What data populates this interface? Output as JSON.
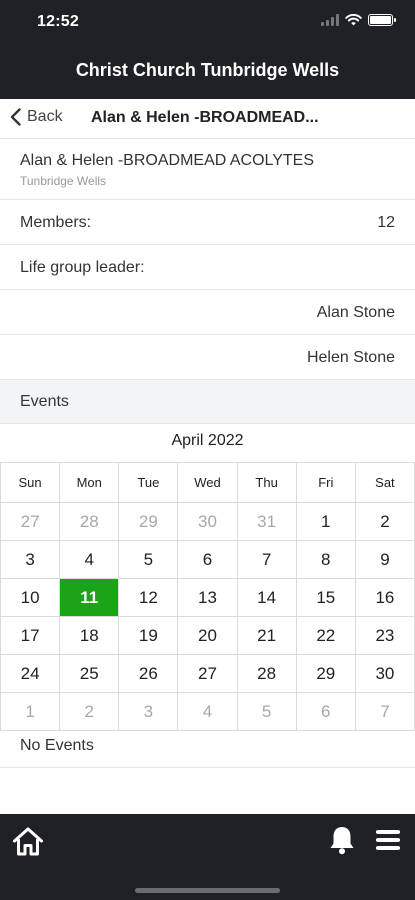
{
  "status": {
    "time": "12:52"
  },
  "header": {
    "app_title": "Christ Church Tunbridge Wells"
  },
  "nav": {
    "back_label": "Back",
    "title": "Alan & Helen -BROADMEAD..."
  },
  "group": {
    "name": "Alan & Helen -BROADMEAD ACOLYTES",
    "location": "Tunbridge Wells",
    "members_label": "Members:",
    "members_count": "12",
    "leader_label": "Life group leader:",
    "leaders": [
      "Alan Stone",
      "Helen Stone"
    ]
  },
  "events": {
    "section_label": "Events",
    "month_label": "April 2022",
    "weekdays": [
      "Sun",
      "Mon",
      "Tue",
      "Wed",
      "Thu",
      "Fri",
      "Sat"
    ],
    "weeks": [
      [
        "27",
        "28",
        "29",
        "30",
        "31",
        "1",
        "2"
      ],
      [
        "3",
        "4",
        "5",
        "6",
        "7",
        "8",
        "9"
      ],
      [
        "10",
        "11",
        "12",
        "13",
        "14",
        "15",
        "16"
      ],
      [
        "17",
        "18",
        "19",
        "20",
        "21",
        "22",
        "23"
      ],
      [
        "24",
        "25",
        "26",
        "27",
        "28",
        "29",
        "30"
      ],
      [
        "1",
        "2",
        "3",
        "4",
        "5",
        "6",
        "7"
      ]
    ],
    "selected_day": "11",
    "empty_label": "No Events"
  },
  "colors": {
    "bar_bg": "#1f2127",
    "today_bg": "#1ba418",
    "section_bg": "#f2f4f7"
  },
  "icons": {
    "back": "chevron-left-icon",
    "tabbar": [
      "home-icon",
      "bell-icon",
      "menu-icon"
    ]
  }
}
